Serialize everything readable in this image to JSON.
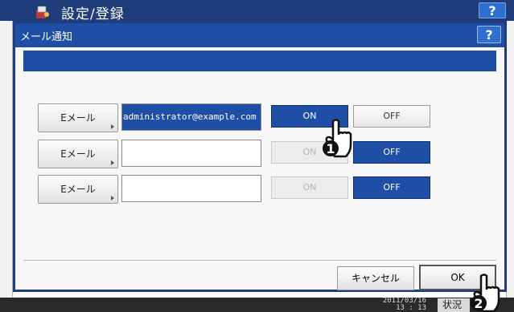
{
  "app": {
    "title": "設定/登録",
    "help_label": "?"
  },
  "dialog": {
    "title": "メール通知",
    "help_label": "?"
  },
  "rows": [
    {
      "button_label": "Eメール",
      "email": "administrator@example.com",
      "on_label": "ON",
      "off_label": "OFF",
      "state": "on",
      "on_enabled": true
    },
    {
      "button_label": "Eメール",
      "email": "",
      "on_label": "ON",
      "off_label": "OFF",
      "state": "off",
      "on_enabled": false
    },
    {
      "button_label": "Eメール",
      "email": "",
      "on_label": "ON",
      "off_label": "OFF",
      "state": "off",
      "on_enabled": false
    }
  ],
  "footer": {
    "cancel_label": "キャンセル",
    "ok_label": "OK",
    "date": "2011/03/16",
    "time": "13 : 13",
    "status_label": "状況"
  },
  "callouts": [
    "1",
    "2"
  ],
  "colors": {
    "accent": "#1f4ea6",
    "header": "#1f3d7a"
  }
}
